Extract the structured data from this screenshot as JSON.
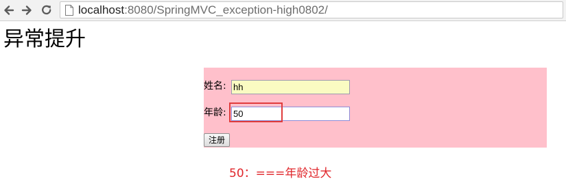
{
  "browser": {
    "url_host": "localhost",
    "url_rest": ":8080/SpringMVC_exception-high0802/",
    "back_icon": "arrow-left-icon",
    "forward_icon": "arrow-right-icon",
    "reload_icon": "reload-icon",
    "page_icon": "document-icon"
  },
  "page": {
    "title": "异常提升"
  },
  "form": {
    "name_label": "姓名:",
    "name_value": "hh",
    "age_label": "年龄:",
    "age_value": "50",
    "submit_label": "注册",
    "panel_color": "#ffc0cb",
    "highlight_color": "#e03b3b"
  },
  "error": {
    "message": "50：===年龄过大",
    "color": "#e0262b"
  }
}
